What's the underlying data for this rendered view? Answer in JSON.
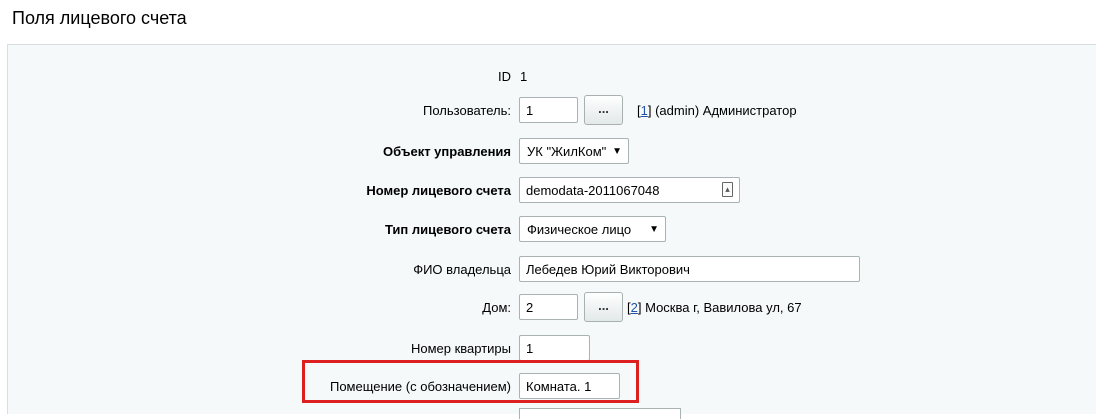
{
  "page": {
    "title": "Поля лицевого счета"
  },
  "form": {
    "id": {
      "label": "ID",
      "value": "1"
    },
    "user": {
      "label": "Пользователь:",
      "value": "1",
      "button": "...",
      "link": "1",
      "info": "(admin) Администратор"
    },
    "object": {
      "label": "Объект управления",
      "selected": "УК \"ЖилКом\""
    },
    "account_number": {
      "label": "Номер лицевого счета",
      "value": "demodata-2011067048"
    },
    "account_type": {
      "label": "Тип лицевого счета",
      "selected": "Физическое лицо"
    },
    "owner": {
      "label": "ФИО владельца",
      "value": "Лебедев Юрий Викторович"
    },
    "house": {
      "label": "Дом:",
      "value": "2",
      "button": "...",
      "link": "2",
      "info": "Москва г, Вавилова ул, 67"
    },
    "apartment": {
      "label": "Номер квартиры",
      "value": "1"
    },
    "room": {
      "label": "Помещение (с обозначением)",
      "value": "Комната. 1"
    }
  },
  "highlight_color": "#dd1f1f"
}
